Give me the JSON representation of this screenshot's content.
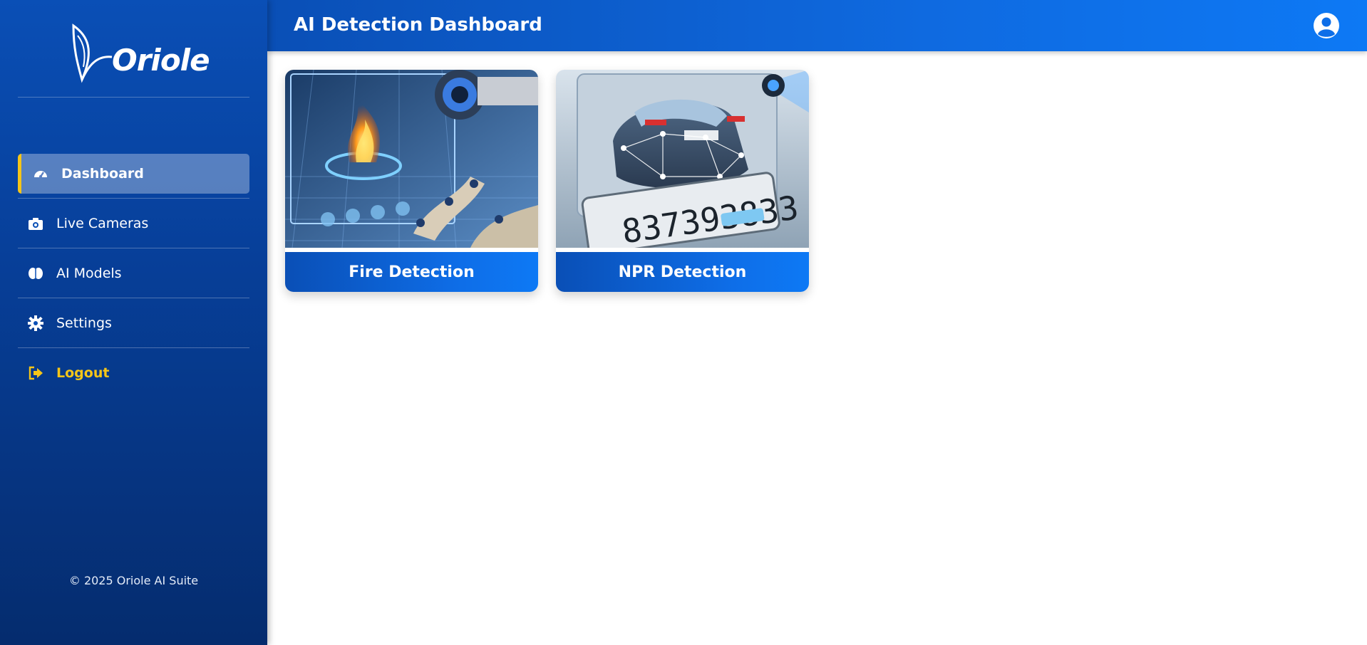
{
  "app": {
    "brand": "Oriole",
    "colors": {
      "primary": "#0a4fb6",
      "accent": "#f5c518",
      "header_end": "#0d79f5"
    }
  },
  "header": {
    "title": "AI Detection Dashboard",
    "user_icon": "user-circle-icon"
  },
  "sidebar": {
    "items": [
      {
        "label": "Dashboard",
        "icon": "gauge-icon",
        "active": true
      },
      {
        "label": "Live Cameras",
        "icon": "camera-icon",
        "active": false
      },
      {
        "label": "AI Models",
        "icon": "brain-icon",
        "active": false
      },
      {
        "label": "Settings",
        "icon": "gear-icon",
        "active": false
      },
      {
        "label": "Logout",
        "icon": "sign-out-icon",
        "active": false
      }
    ],
    "footer": "© 2025 Oriole AI Suite"
  },
  "cards": [
    {
      "label": "Fire Detection",
      "image": "fire-detection-illustration"
    },
    {
      "label": "NPR Detection",
      "image": "npr-detection-illustration"
    }
  ]
}
